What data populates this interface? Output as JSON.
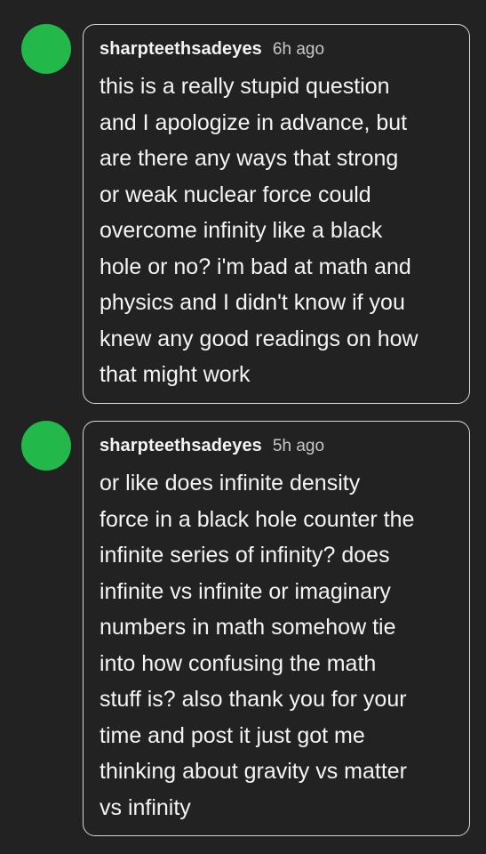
{
  "theme": {
    "background": "#222222",
    "avatar_color": "#22b94a",
    "bubble_border": "#d6d6d6"
  },
  "messages": [
    {
      "username": "sharpteethsadeyes",
      "timestamp": "6h ago",
      "lines": [
        "this is a really stupid question",
        "and I apologize in advance, but",
        "are there any ways that strong",
        "or weak nuclear force could",
        "overcome infinity like a black",
        "hole or no? i'm bad at math and",
        "physics and I didn't know if you",
        "knew any good readings on how",
        "that might work"
      ]
    },
    {
      "username": "sharpteethsadeyes",
      "timestamp": "5h ago",
      "lines": [
        "or like does infinite density",
        "force in a black hole counter the",
        "infinite series of infinity? does",
        "infinite vs infinite or imaginary",
        "numbers in math somehow tie",
        "into how confusing the math",
        "stuff is? also thank you for your",
        "time and post it just got me",
        "thinking about gravity vs matter",
        "vs infinity"
      ]
    }
  ]
}
